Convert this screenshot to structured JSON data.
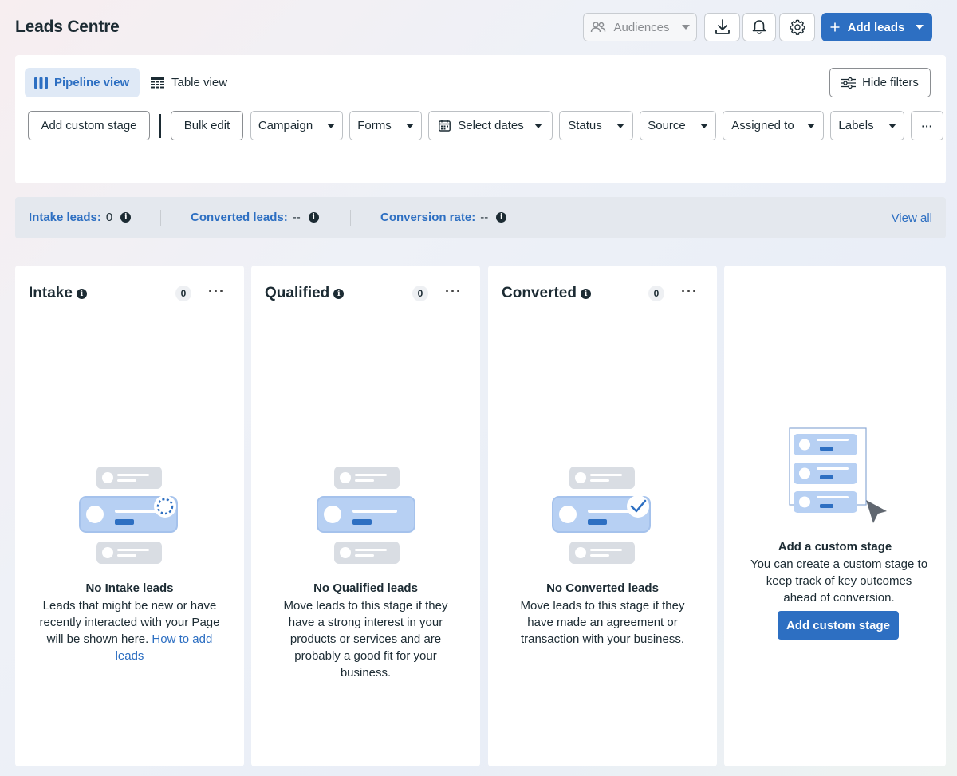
{
  "header": {
    "title": "Leads Centre",
    "audiences_label": "Audiences",
    "add_leads_label": "Add leads"
  },
  "views": {
    "pipeline_label": "Pipeline view",
    "table_label": "Table view",
    "hide_filters_label": "Hide filters"
  },
  "filters": {
    "add_custom_stage": "Add custom stage",
    "bulk_edit": "Bulk edit",
    "campaign": "Campaign",
    "forms": "Forms",
    "select_dates": "Select dates",
    "status": "Status",
    "source": "Source",
    "assigned_to": "Assigned to",
    "labels": "Labels",
    "more": "···"
  },
  "metrics": {
    "intake_label": "Intake leads:",
    "intake_value": "0",
    "converted_label": "Converted leads:",
    "converted_value": "--",
    "rate_label": "Conversion rate:",
    "rate_value": "--",
    "view_all": "View all"
  },
  "columns": [
    {
      "title": "Intake",
      "count": "0",
      "empty_title": "No Intake leads",
      "empty_desc": "Leads that might be new or have recently interacted with your Page will be shown here.",
      "link": "How to add leads"
    },
    {
      "title": "Qualified",
      "count": "0",
      "empty_title": "No Qualified leads",
      "empty_desc": "Move leads to this stage if they have a strong interest in your products or services and are probably a good fit for your business."
    },
    {
      "title": "Converted",
      "count": "0",
      "empty_title": "No Converted leads",
      "empty_desc": "Move leads to this stage if they have made an agreement or transaction with your business."
    }
  ],
  "custom_stage": {
    "title": "Add a custom stage",
    "desc": "You can create a custom stage to keep track of key outcomes ahead of conversion.",
    "button": "Add custom stage"
  },
  "colors": {
    "accent": "#2d6fc2",
    "text": "#1c2b33"
  }
}
